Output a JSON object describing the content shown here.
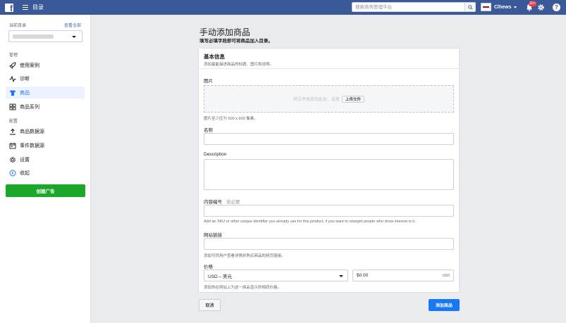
{
  "topbar": {
    "app_title": "目录",
    "search_placeholder": "搜索商务管理平台",
    "account_name": "Clhews",
    "notification_badge": "20+",
    "help_label": "?"
  },
  "sidebar": {
    "current_catalog_label": "当前目录",
    "view_all": "查看全部",
    "sections": [
      "管理",
      "配置"
    ],
    "items": [
      {
        "label": "使用案例",
        "icon": "rocket-icon",
        "active": false
      },
      {
        "label": "诊断",
        "icon": "pulse-icon",
        "active": false
      },
      {
        "label": "商品",
        "icon": "shirt-icon",
        "active": true
      },
      {
        "label": "商品系列",
        "icon": "grid-icon",
        "active": false
      },
      {
        "label": "商品数据源",
        "icon": "upload-icon",
        "active": false
      },
      {
        "label": "事件数据源",
        "icon": "calendar-icon",
        "active": false
      },
      {
        "label": "设置",
        "icon": "gear-icon",
        "active": false
      },
      {
        "label": "收起",
        "icon": "collapse-icon",
        "active": false
      }
    ],
    "create_ad_label": "创建广告"
  },
  "main": {
    "title": "手动添加商品",
    "subtitle": "填写必填字段即可将商品加入目录。",
    "card": {
      "title": "基本信息",
      "description": "添加最能描述商品的标题、图片和说明。"
    },
    "image": {
      "label": "图片",
      "dropzone_text": "将文件拖放到此处，或者",
      "upload_label": "上传文件",
      "help": "图片至少应为 600 x 600 像素。"
    },
    "name": {
      "label": "名称",
      "value": ""
    },
    "description": {
      "label": "Description",
      "value": ""
    },
    "content_id": {
      "label": "内容编号",
      "optional": "非必要",
      "value": "",
      "help": "Add an SKU or other unique identifier you already use for this product, if you want to retarget people who show interest in it."
    },
    "website": {
      "label": "网站链接",
      "value": "",
      "help": "添加可供用户查看详情并购买商品的网页链接。"
    },
    "price": {
      "label": "价格",
      "currency": "USD – 美元",
      "value": "$0.00",
      "unit": "USD",
      "help": "添加你在网站上为这一商品显示的相同价格。"
    }
  },
  "footer": {
    "cancel_label": "取消",
    "add_label": "添加商品"
  },
  "colors": {
    "topbar": "#3b5998",
    "primary": "#1877f2",
    "create_ad": "#1aa72a",
    "active_item_bg": "#ecf3ff"
  }
}
